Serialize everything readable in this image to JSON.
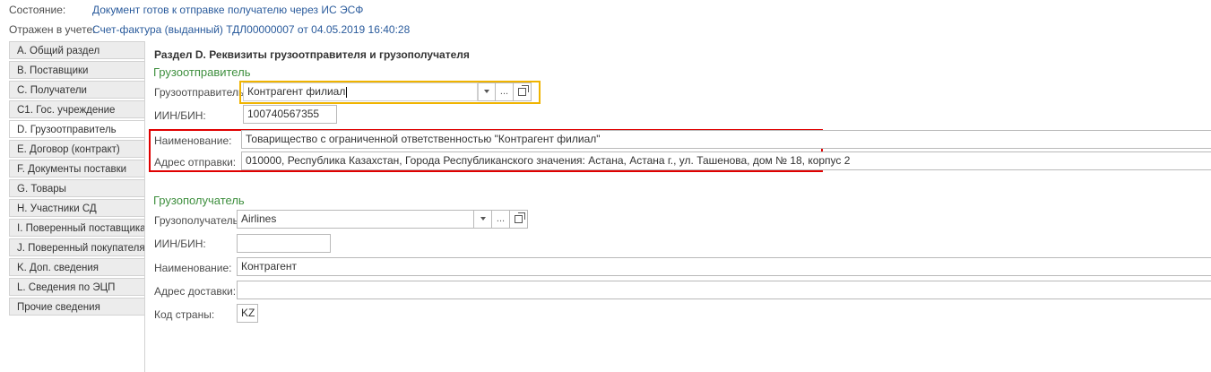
{
  "status": {
    "label": "Состояние:",
    "value": "Документ готов к отправке получателю через ИС ЭСФ"
  },
  "reflected": {
    "label": "Отражен в учете:",
    "value": "Счет-фактура (выданный) ТДЛ00000007 от 04.05.2019 16:40:28"
  },
  "tabs": [
    {
      "label": "A. Общий раздел"
    },
    {
      "label": "B. Поставщики"
    },
    {
      "label": "C. Получатели"
    },
    {
      "label": "C1. Гос. учреждение"
    },
    {
      "label": "D. Грузоотправитель"
    },
    {
      "label": "E. Договор (контракт)"
    },
    {
      "label": "F. Документы поставки"
    },
    {
      "label": "G. Товары"
    },
    {
      "label": "H. Участники СД"
    },
    {
      "label": "I. Поверенный поставщика"
    },
    {
      "label": "J. Поверенный покупателя"
    },
    {
      "label": "K. Доп. сведения"
    },
    {
      "label": "L. Сведения по ЭЦП"
    },
    {
      "label": "Прочие сведения"
    }
  ],
  "active_tab": "D. Грузоотправитель",
  "section_title": "Раздел D. Реквизиты грузоотправителя и грузополучателя",
  "shipper": {
    "group_title": "Грузоотправитель",
    "shipper_label": "Грузоотправитель:",
    "shipper_value": "Контрагент филиал",
    "iin_label": "ИИН/БИН:",
    "iin_value": "100740567355",
    "name_label": "Наименование:",
    "name_value": "Товарищество с ограниченной ответственностью \"Контрагент филиал\"",
    "address_label": "Адрес отправки:",
    "address_value": "010000, Республика Казахстан, Города Республиканского значения: Астана, Астана г., ул. Ташенова, дом № 18, корпус 2"
  },
  "consignee": {
    "group_title": "Грузополучатель",
    "consignee_label": "Грузополучатель:",
    "consignee_value": "Airlines",
    "iin_label": "ИИН/БИН:",
    "iin_value": "",
    "name_label": "Наименование:",
    "name_value": "Контрагент",
    "address_label": "Адрес доставки:",
    "address_value": "",
    "country_label": "Код страны:",
    "country_value": "KZ"
  },
  "buttons": {
    "ellipsis": "..."
  },
  "colors": {
    "link": "#2a5b9c",
    "group_title": "#3e8f3e",
    "focus_border": "#f0b400",
    "highlight_border": "#e00000"
  }
}
